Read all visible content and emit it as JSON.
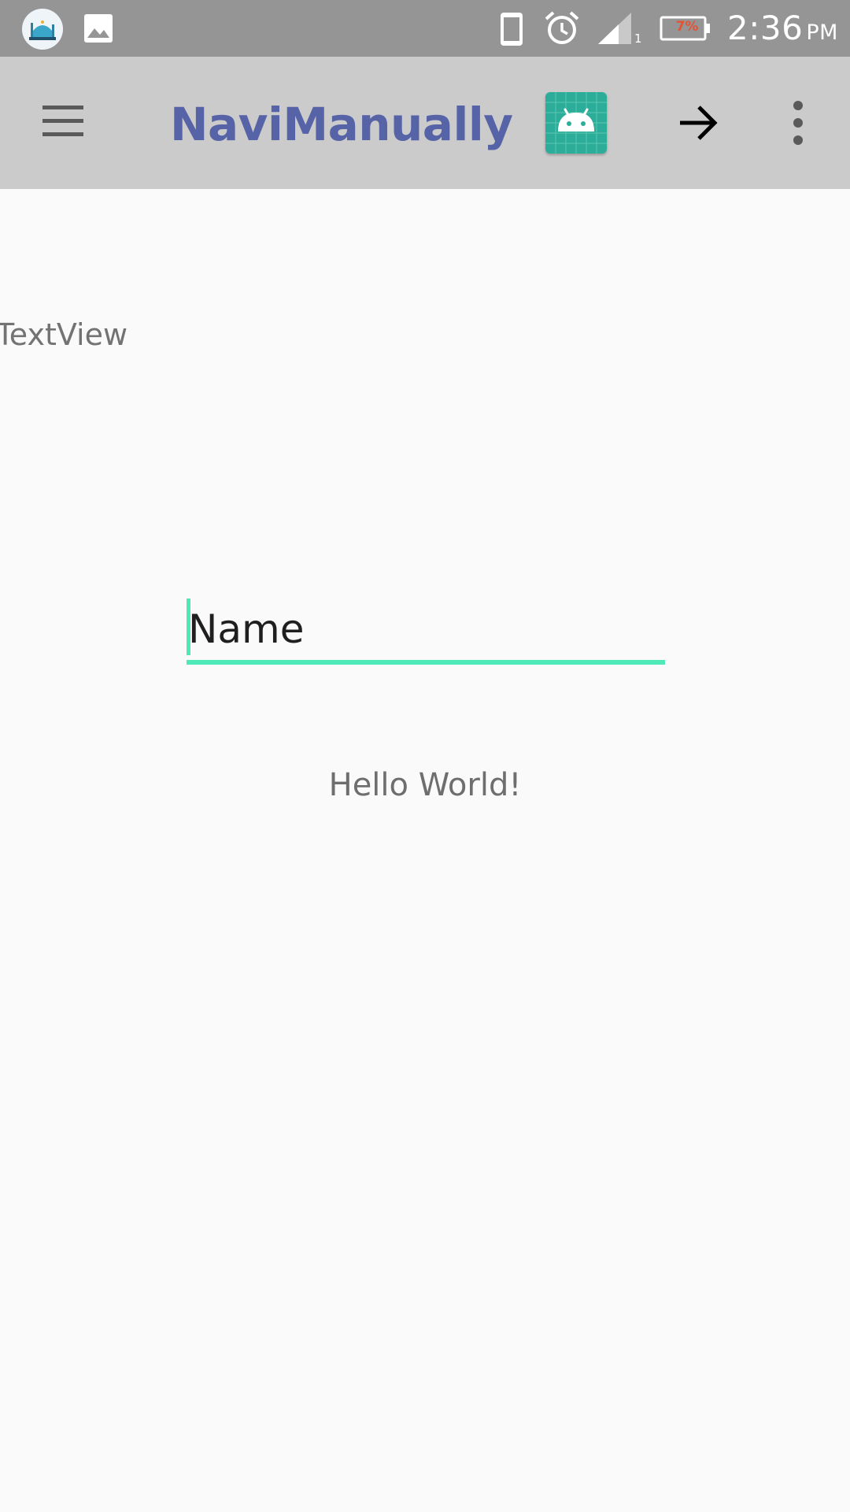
{
  "status_bar": {
    "time": "2:36",
    "ampm": "PM",
    "battery_percent": "7%",
    "signal_sim": "1",
    "icons": [
      "mosque-app-icon",
      "gallery-icon",
      "phone-icon",
      "alarm-icon",
      "signal-icon",
      "battery-icon"
    ]
  },
  "app_bar": {
    "title": "NaviManually",
    "background": "#cbcbcb",
    "title_color": "#5663a6",
    "icons": [
      "menu-icon",
      "android-icon",
      "arrow-forward-icon",
      "more-vert-icon"
    ]
  },
  "main": {
    "textview_label": "TextView",
    "name_input": {
      "value": "Name",
      "accent_color": "#4ee9b7"
    },
    "hello_text": "Hello World!"
  }
}
